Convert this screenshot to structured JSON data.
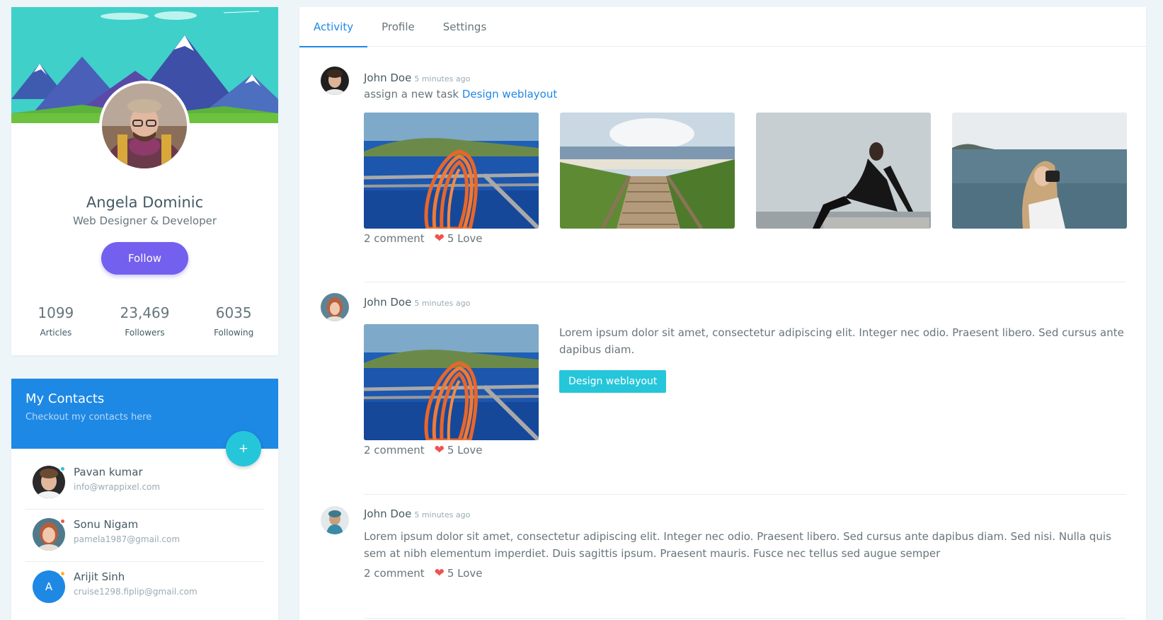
{
  "profile": {
    "name": "Angela Dominic",
    "role": "Web Designer & Developer",
    "follow_label": "Follow",
    "stats": [
      {
        "value": "1099",
        "label": "Articles"
      },
      {
        "value": "23,469",
        "label": "Followers"
      },
      {
        "value": "6035",
        "label": "Following"
      }
    ]
  },
  "contacts": {
    "title": "My Contacts",
    "subtitle": "Checkout my contacts here",
    "add_label": "+",
    "items": [
      {
        "name": "Pavan kumar",
        "email": "info@wrappixel.com",
        "status_color": "#26c6da"
      },
      {
        "name": "Sonu Nigam",
        "email": "pamela1987@gmail.com",
        "status_color": "#ef5350"
      },
      {
        "name": "Arijit Sinh",
        "email": "cruise1298.fiplip@gmail.com",
        "status_color": "#ffb22b",
        "initial": "A"
      }
    ]
  },
  "tabs": [
    {
      "label": "Activity",
      "active": true
    },
    {
      "label": "Profile",
      "active": false
    },
    {
      "label": "Settings",
      "active": false
    }
  ],
  "feed": [
    {
      "user": "John Doe",
      "time": "5 minutes ago",
      "action": "assign a new task",
      "link": "Design weblayout",
      "comments": "2 comment",
      "loves": "5 Love"
    },
    {
      "user": "John Doe",
      "time": "5 minutes ago",
      "text": "Lorem ipsum dolor sit amet, consectetur adipiscing elit. Integer nec odio. Praesent libero. Sed cursus ante dapibus diam.",
      "button": "Design weblayout",
      "comments": "2 comment",
      "loves": "5 Love"
    },
    {
      "user": "John Doe",
      "time": "5 minutes ago",
      "text": "Lorem ipsum dolor sit amet, consectetur adipiscing elit. Integer nec odio. Praesent libero. Sed cursus ante dapibus diam. Sed nisi. Nulla quis sem at nibh elementum imperdiet. Duis sagittis ipsum. Praesent mauris. Fusce nec tellus sed augue semper",
      "comments": "2 comment",
      "loves": "5 Love"
    }
  ],
  "colors": {
    "primary": "#1e88e5",
    "purple": "#7460ee",
    "cyan": "#26c6da",
    "danger": "#ef5350",
    "background": "#eef5f9"
  },
  "icons": {
    "heart": "heart-icon",
    "plus": "plus-icon"
  }
}
